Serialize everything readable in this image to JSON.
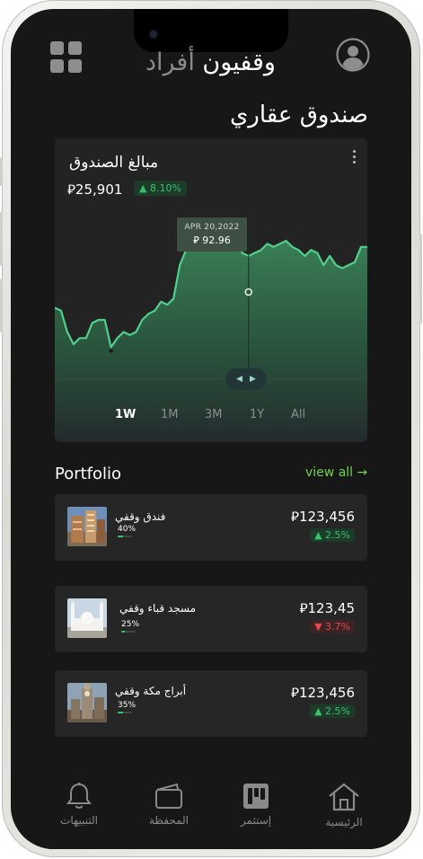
{
  "header": {
    "app_title_main": "وقفيون",
    "app_title_muted": " أفراد",
    "page_title": "صندوق عقاري"
  },
  "fund_card": {
    "title": "مبالغ الصندوق",
    "currency_symbol": "⃁",
    "amount": "25,901",
    "change": "▲ 8.10%",
    "tooltip_date": "APR 20,2022",
    "tooltip_value": "92.96",
    "range_left": "◀",
    "range_right": "▶",
    "periods": [
      "1W",
      "1M",
      "3M",
      "1Y",
      "All"
    ],
    "active_period": "1W"
  },
  "chart_data": {
    "type": "area",
    "x_index": [
      0,
      1,
      2,
      3,
      4,
      5,
      6,
      7,
      8,
      9,
      10,
      11,
      12,
      13,
      14,
      15,
      16,
      17,
      18,
      19,
      20,
      21,
      22,
      23,
      24,
      25,
      26,
      27,
      28,
      29,
      30,
      31,
      32,
      33,
      34,
      35,
      36,
      37,
      38,
      39,
      40,
      41,
      42,
      43,
      44,
      45,
      46,
      47,
      48,
      49,
      50
    ],
    "values": [
      70,
      69,
      62,
      58,
      60,
      60,
      65,
      66,
      66,
      57,
      60,
      62,
      61,
      62,
      66,
      68,
      69,
      72,
      71,
      73,
      84,
      89,
      92,
      92,
      92,
      93,
      93,
      91,
      97,
      93,
      88,
      87,
      88,
      89,
      91,
      90,
      91,
      92,
      90,
      89,
      87,
      89,
      88,
      84,
      87,
      84,
      83,
      84,
      85,
      90,
      90
    ],
    "ylim": [
      40,
      105
    ],
    "highlight": {
      "date": "APR 20,2022",
      "value": 92.96
    },
    "line_color": "#4fd18b"
  },
  "portfolio": {
    "title": "Portfolio",
    "view_all": "view all →",
    "items": [
      {
        "name": "فندق وقفي",
        "pct": "40%",
        "progress": 0.4,
        "amount": "⃁123,456",
        "change": "▲ 2.5%",
        "direction": "up"
      },
      {
        "name": "مسجد قباء وقفي",
        "pct": "25%",
        "progress": 0.25,
        "amount": "⃁123,45",
        "change": "▼ 3.7%",
        "direction": "down"
      },
      {
        "name": "أبراج مكة وقفي",
        "pct": "35%",
        "progress": 0.35,
        "amount": "⃁123,456",
        "change": "▲ 2.5%",
        "direction": "up"
      }
    ]
  },
  "tabbar": {
    "items": [
      {
        "label": "التنبيهات",
        "icon": "bell-icon"
      },
      {
        "label": "المحفظة",
        "icon": "wallet-icon"
      },
      {
        "label": "إستثمر",
        "icon": "invest-icon"
      },
      {
        "label": "الرئيسية",
        "icon": "home-icon"
      }
    ]
  }
}
